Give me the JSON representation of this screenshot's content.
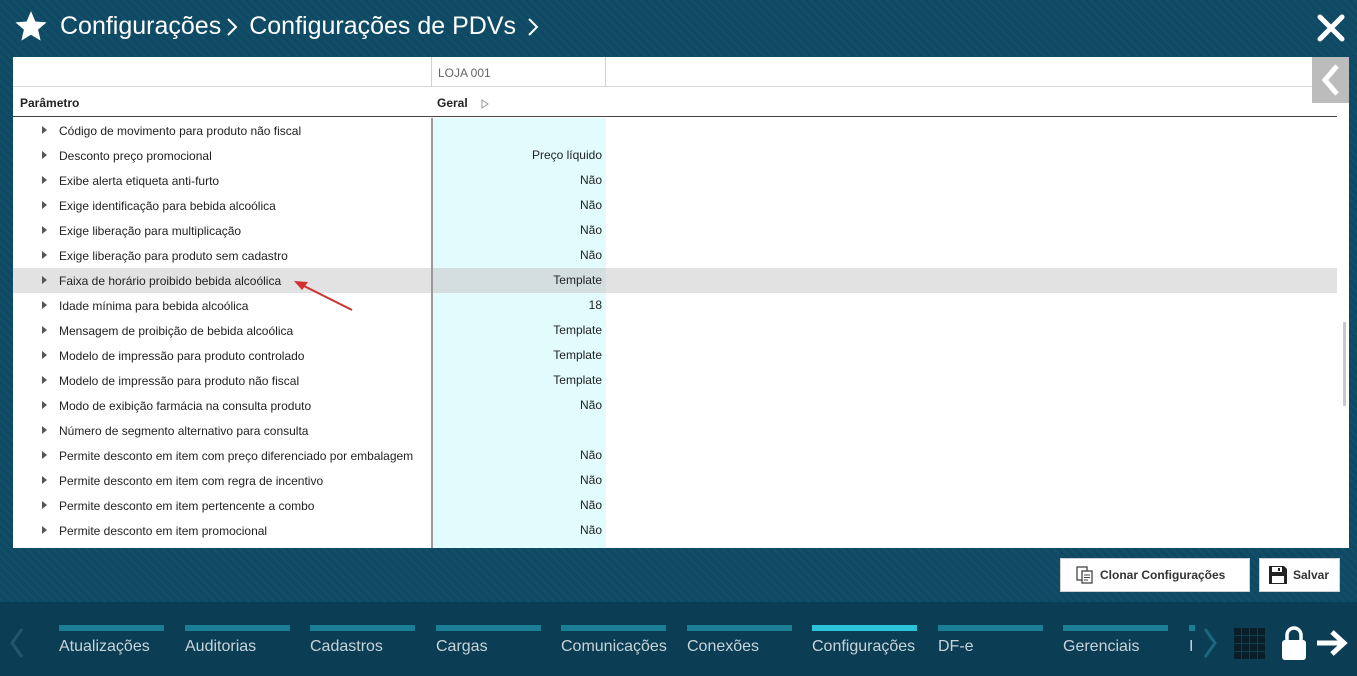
{
  "header": {
    "breadcrumbs": [
      "Configurações",
      "Configurações de PDVs"
    ]
  },
  "grid": {
    "store_column": "LOJA 001",
    "param_header": "Parâmetro",
    "group_header": "Geral",
    "rows": [
      {
        "label": "Código de movimento para produto não fiscal",
        "value": ""
      },
      {
        "label": "Desconto preço promocional",
        "value": "Preço líquido"
      },
      {
        "label": "Exibe alerta etiqueta anti-furto",
        "value": "Não"
      },
      {
        "label": "Exige identificação para bebida alcoólica",
        "value": "Não"
      },
      {
        "label": "Exige liberação para multiplicação",
        "value": "Não"
      },
      {
        "label": "Exige liberação para produto sem cadastro",
        "value": "Não"
      },
      {
        "label": "Faixa de horário proibido bebida alcoólica",
        "value": "Template",
        "selected": true
      },
      {
        "label": "Idade mínima para bebida alcoólica",
        "value": "18"
      },
      {
        "label": "Mensagem de proibição de bebida alcoólica",
        "value": "Template"
      },
      {
        "label": "Modelo de impressão para produto controlado",
        "value": "Template"
      },
      {
        "label": "Modelo de impressão para produto não fiscal",
        "value": "Template"
      },
      {
        "label": "Modo de exibição farmácia na consulta produto",
        "value": "Não"
      },
      {
        "label": "Número de segmento alternativo para consulta",
        "value": ""
      },
      {
        "label": "Permite desconto em item com preço diferenciado por embalagem",
        "value": "Não"
      },
      {
        "label": "Permite desconto em item com regra de incentivo",
        "value": "Não"
      },
      {
        "label": "Permite desconto em item pertencente a combo",
        "value": "Não"
      },
      {
        "label": "Permite desconto em item promocional",
        "value": "Não"
      }
    ]
  },
  "actions": {
    "clone_label": "Clonar Configurações",
    "save_label": "Salvar"
  },
  "footer": {
    "tabs": [
      {
        "label": "Atualizações",
        "active": false
      },
      {
        "label": "Auditorias",
        "active": false
      },
      {
        "label": "Cadastros",
        "active": false
      },
      {
        "label": "Cargas",
        "active": false
      },
      {
        "label": "Comunicações",
        "active": false
      },
      {
        "label": "Conexões",
        "active": false
      },
      {
        "label": "Configurações",
        "active": true
      },
      {
        "label": "DF-e",
        "active": false
      },
      {
        "label": "Gerenciais",
        "active": false
      },
      {
        "label": "I",
        "active": false
      }
    ]
  },
  "colors": {
    "background": "#0e4a64",
    "footer": "#0b3e55",
    "accent": "#2bc3d9",
    "value_column": "#e2fbfc",
    "selected_row": "#e2e2e2",
    "annotation": "#d32f2f"
  },
  "icons": [
    "star-icon",
    "chevron-right-icon",
    "close-icon",
    "chevron-left-icon",
    "caret-right-icon",
    "clone-icon",
    "save-icon",
    "grid-icon",
    "lock-icon",
    "arrow-right-icon"
  ]
}
